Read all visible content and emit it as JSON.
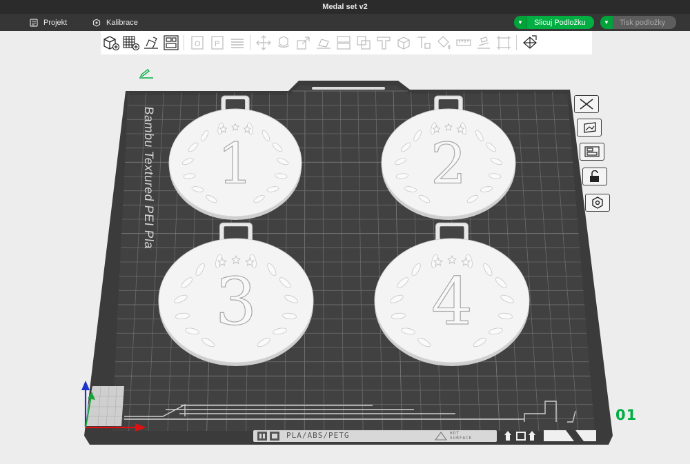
{
  "window": {
    "title": "Medal set v2"
  },
  "menubar": {
    "project_label": "Projekt",
    "calibration_label": "Kalibrace",
    "slice_button_label": "Slicuj Podložku",
    "print_button_label": "Tisk podložky"
  },
  "plate": {
    "name": "Bambu Textured PEI Plate",
    "id_label": "01",
    "filament_label": "PLA/ABS/PETG",
    "hot_surface_line1": "HOT",
    "hot_surface_line2": "SURFACE"
  },
  "medals": [
    {
      "number": "1"
    },
    {
      "number": "2"
    },
    {
      "number": "3"
    },
    {
      "number": "4"
    }
  ],
  "colors": {
    "accent": "#00ae42",
    "plate": "#3d3d3d",
    "grid": "#6a6a6a",
    "medal": "#f2f2f2"
  },
  "icons": {
    "toolbar": [
      "add-cube-icon",
      "add-plate-grid-icon",
      "auto-orient-icon",
      "arrange-icon",
      "object-settings-icon",
      "plate-settings-icon",
      "layers-icon",
      "move-icon",
      "rotate-icon",
      "scale-icon",
      "lay-on-face-icon",
      "cut-icon",
      "boolean-icon",
      "support-paint-icon",
      "seam-paint-icon",
      "text-icon",
      "color-paint-icon",
      "measure-icon",
      "assembly-icon",
      "emboss-icon",
      "split-view-icon"
    ],
    "side": [
      "close-plate-icon",
      "pick-plate-icon",
      "arrange-plate-icon",
      "lock-plate-icon",
      "plate-settings-icon"
    ]
  }
}
